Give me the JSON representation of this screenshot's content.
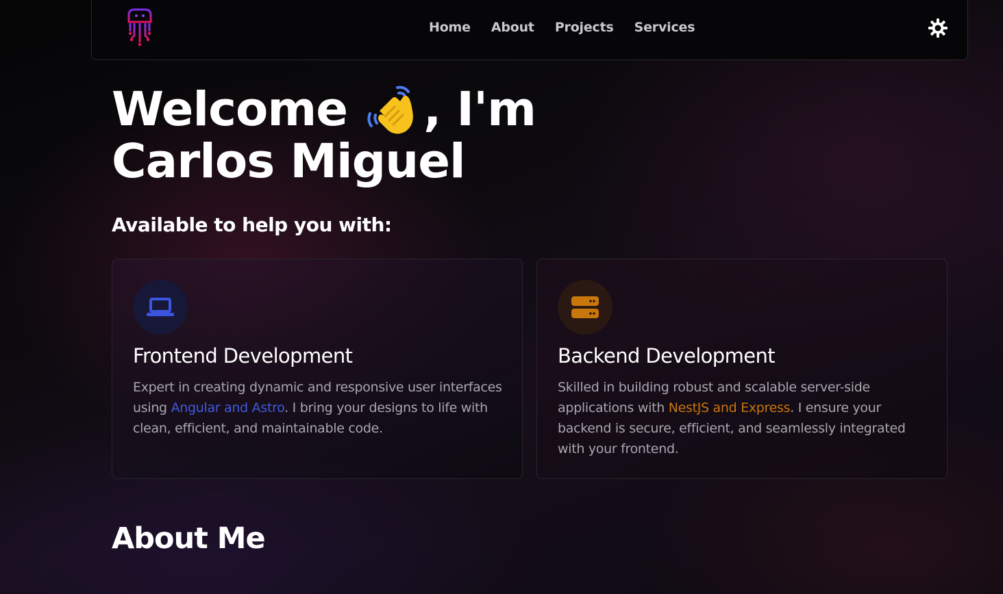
{
  "header": {
    "logo_icon": "jellyfish-circuit-logo-icon",
    "nav": [
      "Home",
      "About",
      "Projects",
      "Services"
    ],
    "theme_toggle_icon": "sun-gear-icon"
  },
  "hero": {
    "line1_before": "Welcome",
    "wave_icon": "waving-hand-icon",
    "line1_after": ", I'm",
    "line2": "Carlos Miguel"
  },
  "services": {
    "heading": "Available to help you with:",
    "cards": [
      {
        "icon": "laptop-icon",
        "icon_color": "#3c55e0",
        "title": "Frontend Development",
        "text_before": "Expert in creating dynamic and responsive user interfaces using ",
        "highlight": "Angular and Astro",
        "highlight_color": "#3f5be0",
        "text_after": ". I bring your designs to life with clean, efficient, and maintainable code."
      },
      {
        "icon": "server-icon",
        "icon_color": "#c9760c",
        "title": "Backend Development",
        "text_before": "Skilled in building robust and scalable server-side applications with ",
        "highlight": "NestJS and Express",
        "highlight_color": "#c9760c",
        "text_after": ". I ensure your backend is secure, efficient, and seamlessly integrated with your frontend."
      }
    ]
  },
  "about": {
    "heading": "About Me"
  }
}
